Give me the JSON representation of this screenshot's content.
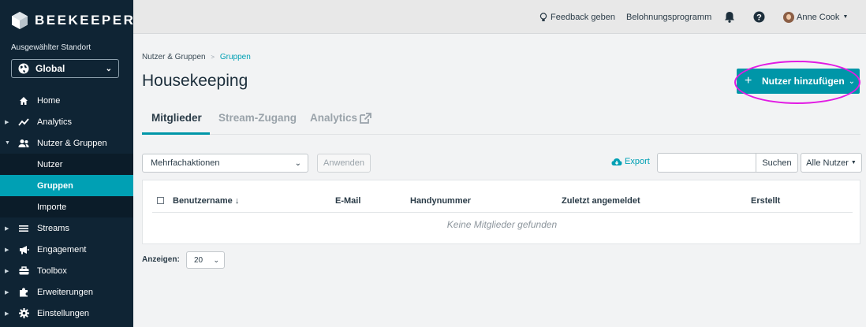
{
  "brand": {
    "name": "BEEKEEPER"
  },
  "location": {
    "label": "Ausgewählter Standort",
    "value": "Global"
  },
  "nav": {
    "home": "Home",
    "analytics": "Analytics",
    "users_groups": "Nutzer & Gruppen",
    "users": "Nutzer",
    "groups": "Gruppen",
    "imports": "Importe",
    "streams": "Streams",
    "engagement": "Engagement",
    "toolbox": "Toolbox",
    "extensions": "Erweiterungen",
    "settings": "Einstellungen"
  },
  "topbar": {
    "feedback": "Feedback geben",
    "rewards": "Belohnungsprogramm",
    "user": "Anne Cook"
  },
  "breadcrumb": {
    "parent": "Nutzer & Gruppen",
    "current": "Gruppen"
  },
  "page": {
    "title": "Housekeeping",
    "add_button": "Nutzer hinzufügen"
  },
  "tabs": [
    "Mitglieder",
    "Stream-Zugang",
    "Analytics"
  ],
  "toolbar": {
    "bulk_actions": "Mehrfachaktionen",
    "apply": "Anwenden",
    "export": "Export",
    "search_value": "",
    "search_button": "Suchen",
    "filter": "Alle Nutzer"
  },
  "table": {
    "columns": [
      "Benutzername",
      "E-Mail",
      "Handynummer",
      "Zuletzt angemeldet",
      "Erstellt"
    ],
    "sort_indicator": "↓",
    "empty": "Keine Mitglieder gefunden"
  },
  "pagination": {
    "label": "Anzeigen:",
    "value": "20"
  },
  "colors": {
    "sidebar": "#0f2434",
    "accent": "#0096a8",
    "highlight": "#e21be4"
  }
}
